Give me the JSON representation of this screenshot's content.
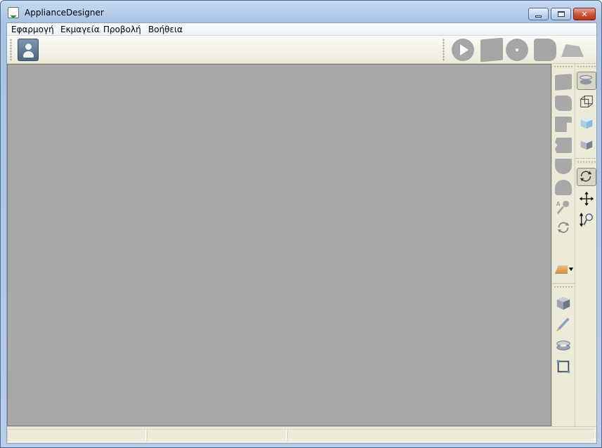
{
  "window": {
    "title": "ApplianceDesigner",
    "app_icon": "app-icon",
    "controls": {
      "minimize": "minimize-icon",
      "maximize": "restore-icon",
      "close": "✕"
    }
  },
  "menubar": {
    "items": [
      {
        "label": "Εφαρμογή"
      },
      {
        "label": "Εκμαγεία"
      },
      {
        "label": "Προβολή"
      },
      {
        "label": "Βοήθεια"
      }
    ]
  },
  "toolbar": {
    "left_tool": "user-panel-icon",
    "right_tools": [
      "play-icon",
      "square-shape-icon",
      "disc-shape-icon",
      "blob-shape-icon",
      "plane-shape-icon"
    ]
  },
  "left_tool_column": {
    "shape_tools": [
      "shape-1-icon",
      "shape-2-icon",
      "shape-3-icon",
      "shape-4-icon",
      "shape-5-icon",
      "shape-6-icon",
      "text-annotation-icon",
      "rotate-icon"
    ],
    "color_dropdown": "material-color-icon",
    "lower_tools": [
      "cube-view-icon",
      "pen-icon",
      "ring-icon",
      "frame-icon"
    ]
  },
  "right_tool_column": {
    "view_tools": [
      "top-view-icon",
      "wireframe-cube-icon",
      "transparent-cube-icon",
      "solid-cube-icon"
    ],
    "nav_tools": [
      "orbit-icon",
      "pan-icon",
      "zoom-icon"
    ]
  },
  "colors": {
    "viewport": "#a8a8a8",
    "panel": "#ecead9",
    "close_button": "#c8452c"
  },
  "statusbar": {
    "panes": [
      "",
      "",
      ""
    ]
  }
}
